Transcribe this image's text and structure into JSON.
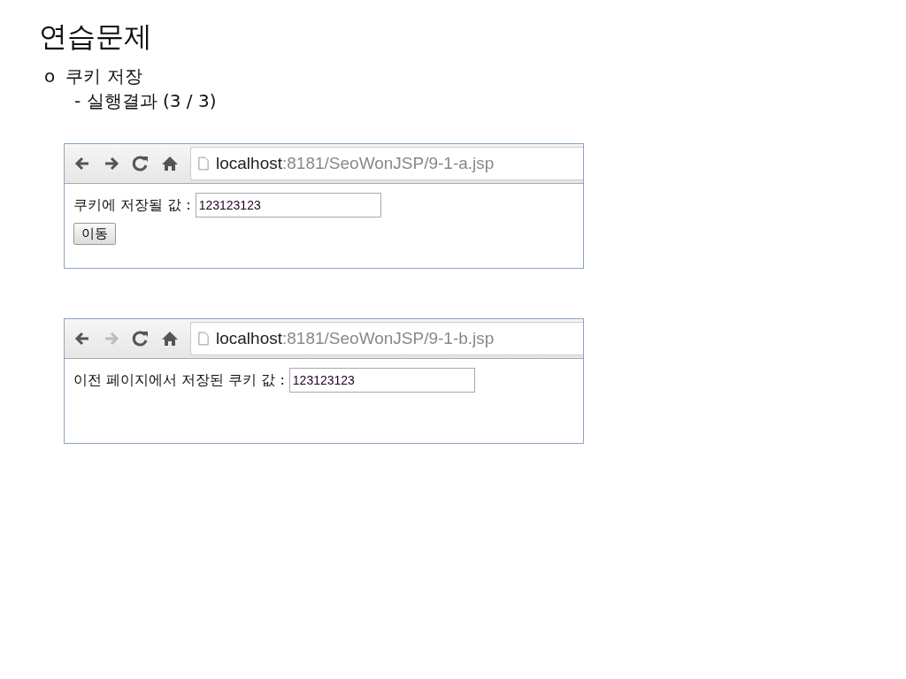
{
  "slide": {
    "title": "연습문제",
    "bullet": "o",
    "heading": "쿠키 저장",
    "subheading": "- 실행결과 (3 / 3)"
  },
  "browsers": [
    {
      "forward_disabled": false,
      "url_host": "localhost",
      "url_path": ":8181/SeoWonJSP/9-1-a.jsp",
      "label": "쿠키에 저장될 값 :",
      "value": "123123123",
      "button": "이동"
    },
    {
      "forward_disabled": true,
      "url_host": "localhost",
      "url_path": ":8181/SeoWonJSP/9-1-b.jsp",
      "label": "이전 페이지에서 저장된 쿠키 값 :",
      "value": "123123123"
    }
  ]
}
